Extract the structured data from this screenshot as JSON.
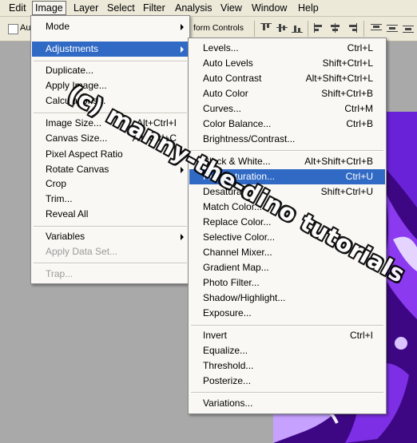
{
  "menubar": {
    "items": [
      "Edit",
      "Image",
      "Layer",
      "Select",
      "Filter",
      "Analysis",
      "View",
      "Window",
      "Help"
    ]
  },
  "options_bar": {
    "auto_select_label": "Au",
    "transform_controls_label": "form Controls"
  },
  "image_menu": {
    "items": [
      {
        "label": "Mode",
        "shortcut": "",
        "submenu": true
      },
      {
        "label": "Adjustments",
        "shortcut": "",
        "submenu": true,
        "highlighted": true
      },
      {
        "label": "Duplicate...",
        "shortcut": ""
      },
      {
        "label": "Apply Image...",
        "shortcut": ""
      },
      {
        "label": "Calculations...",
        "shortcut": ""
      },
      {
        "label": "Image Size...",
        "shortcut": "Alt+Ctrl+I"
      },
      {
        "label": "Canvas Size...",
        "shortcut": "Alt+Ctrl+C"
      },
      {
        "label": "Pixel Aspect Ratio",
        "shortcut": "",
        "submenu": true
      },
      {
        "label": "Rotate Canvas",
        "shortcut": "",
        "submenu": true
      },
      {
        "label": "Crop",
        "shortcut": ""
      },
      {
        "label": "Trim...",
        "shortcut": ""
      },
      {
        "label": "Reveal All",
        "shortcut": ""
      },
      {
        "label": "Variables",
        "shortcut": "",
        "submenu": true
      },
      {
        "label": "Apply Data Set...",
        "shortcut": "",
        "disabled": true
      },
      {
        "label": "Trap...",
        "shortcut": "",
        "disabled": true
      }
    ]
  },
  "adjustments_menu": {
    "items": [
      {
        "label": "Levels...",
        "shortcut": "Ctrl+L"
      },
      {
        "label": "Auto Levels",
        "shortcut": "Shift+Ctrl+L"
      },
      {
        "label": "Auto Contrast",
        "shortcut": "Alt+Shift+Ctrl+L"
      },
      {
        "label": "Auto Color",
        "shortcut": "Shift+Ctrl+B"
      },
      {
        "label": "Curves...",
        "shortcut": "Ctrl+M"
      },
      {
        "label": "Color Balance...",
        "shortcut": "Ctrl+B"
      },
      {
        "label": "Brightness/Contrast...",
        "shortcut": ""
      },
      {
        "label": "Black & White...",
        "shortcut": "Alt+Shift+Ctrl+B"
      },
      {
        "label": "Hue/Saturation...",
        "shortcut": "Ctrl+U",
        "highlighted": true
      },
      {
        "label": "Desaturate",
        "shortcut": "Shift+Ctrl+U"
      },
      {
        "label": "Match Color...",
        "shortcut": ""
      },
      {
        "label": "Replace Color...",
        "shortcut": ""
      },
      {
        "label": "Selective Color...",
        "shortcut": ""
      },
      {
        "label": "Channel Mixer...",
        "shortcut": ""
      },
      {
        "label": "Gradient Map...",
        "shortcut": ""
      },
      {
        "label": "Photo Filter...",
        "shortcut": ""
      },
      {
        "label": "Shadow/Highlight...",
        "shortcut": ""
      },
      {
        "label": "Exposure...",
        "shortcut": ""
      },
      {
        "label": "Invert",
        "shortcut": "Ctrl+I"
      },
      {
        "label": "Equalize...",
        "shortcut": ""
      },
      {
        "label": "Threshold...",
        "shortcut": ""
      },
      {
        "label": "Posterize...",
        "shortcut": ""
      },
      {
        "label": "Variations...",
        "shortcut": ""
      }
    ]
  },
  "watermark": "(c) manny-the-dino tutorials",
  "colors": {
    "highlight": "#316ac5",
    "menu_bg": "#f9f8f4",
    "chrome": "#ece9d8",
    "photo_purple": "#4a0a9a"
  }
}
